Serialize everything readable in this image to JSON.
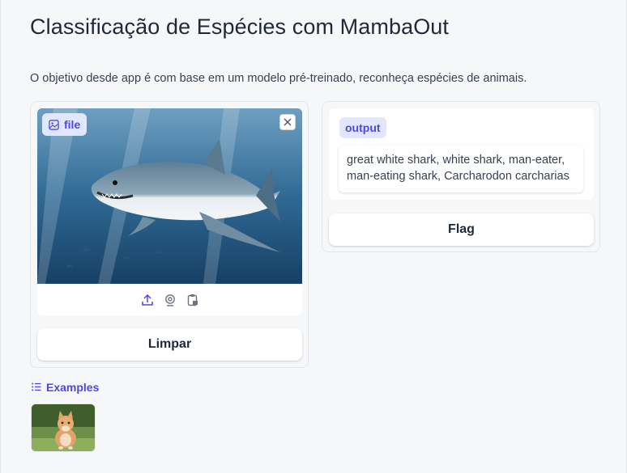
{
  "header": {
    "title": "Classificação de Espécies com MambaOut",
    "description": "O objetivo desde app é com base em um modelo pré-treinado, reconheça espécies de animais."
  },
  "input": {
    "badge_label": "file",
    "image_subject": "great white shark underwater",
    "source_icons": [
      "upload-icon",
      "webcam-icon",
      "clipboard-icon"
    ],
    "clear_button": "Limpar"
  },
  "output": {
    "label": "output",
    "text": "great white shark, white shark, man-eater, man-eating shark, Carcharodon carcharias",
    "flag_button": "Flag"
  },
  "examples": {
    "label": "Examples",
    "items": [
      {
        "subject": "kitten on grass"
      }
    ]
  },
  "colors": {
    "accent": "#4f46e5",
    "accent_bg": "#e0e7ff",
    "page_bg": "#f6f7f9"
  }
}
